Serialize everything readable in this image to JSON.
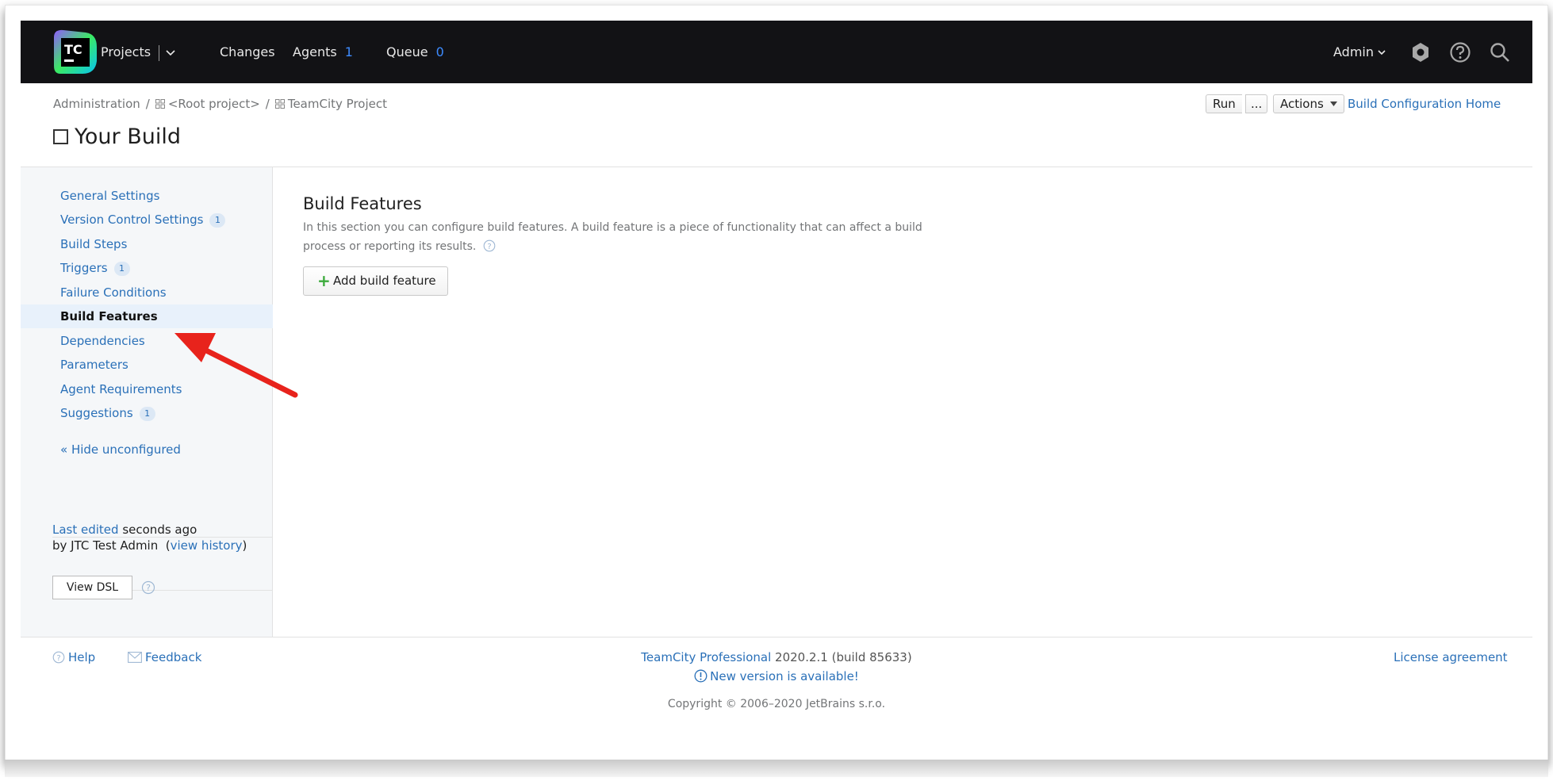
{
  "header": {
    "logo_text": "TC",
    "nav": {
      "projects": "Projects",
      "changes": "Changes",
      "agents": "Agents",
      "agents_count": "1",
      "queue": "Queue",
      "queue_count": "0"
    },
    "user": "Admin"
  },
  "breadcrumb": {
    "admin": "Administration",
    "root": "<Root project>",
    "project": "TeamCity Project",
    "separator": "/"
  },
  "page": {
    "title": "Your Build",
    "run_label": "Run",
    "more_label": "...",
    "actions_label": "Actions",
    "home_link": "Build Configuration Home"
  },
  "sidebar": {
    "items": [
      {
        "label": "General Settings",
        "count": ""
      },
      {
        "label": "Version Control Settings",
        "count": "1"
      },
      {
        "label": "Build Steps",
        "count": ""
      },
      {
        "label": "Triggers",
        "count": "1"
      },
      {
        "label": "Failure Conditions",
        "count": ""
      },
      {
        "label": "Build Features",
        "count": ""
      },
      {
        "label": "Dependencies",
        "count": ""
      },
      {
        "label": "Parameters",
        "count": ""
      },
      {
        "label": "Agent Requirements",
        "count": ""
      },
      {
        "label": "Suggestions",
        "count": "1"
      }
    ],
    "hide_link": "« Hide unconfigured",
    "last_edited_link": "Last edited",
    "last_edited_time": "seconds ago",
    "edited_by": "by JTC Test Admin",
    "view_history": "view history",
    "view_dsl": "View DSL"
  },
  "content": {
    "title": "Build Features",
    "description": "In this section you can configure build features. A build feature is a piece of functionality that can affect a build process or reporting its results.",
    "add_button": "Add build feature"
  },
  "footer": {
    "help": "Help",
    "feedback": "Feedback",
    "product": "TeamCity Professional",
    "version": "2020.2.1 (build 85633)",
    "new_version": "New version is available!",
    "copyright": "Copyright © 2006–2020 JetBrains s.r.o.",
    "license": "License agreement"
  },
  "colors": {
    "header_bg": "#121215",
    "link": "#2a70b8",
    "accent_count": "#3d8bff",
    "annotation_arrow": "#e8231c"
  }
}
